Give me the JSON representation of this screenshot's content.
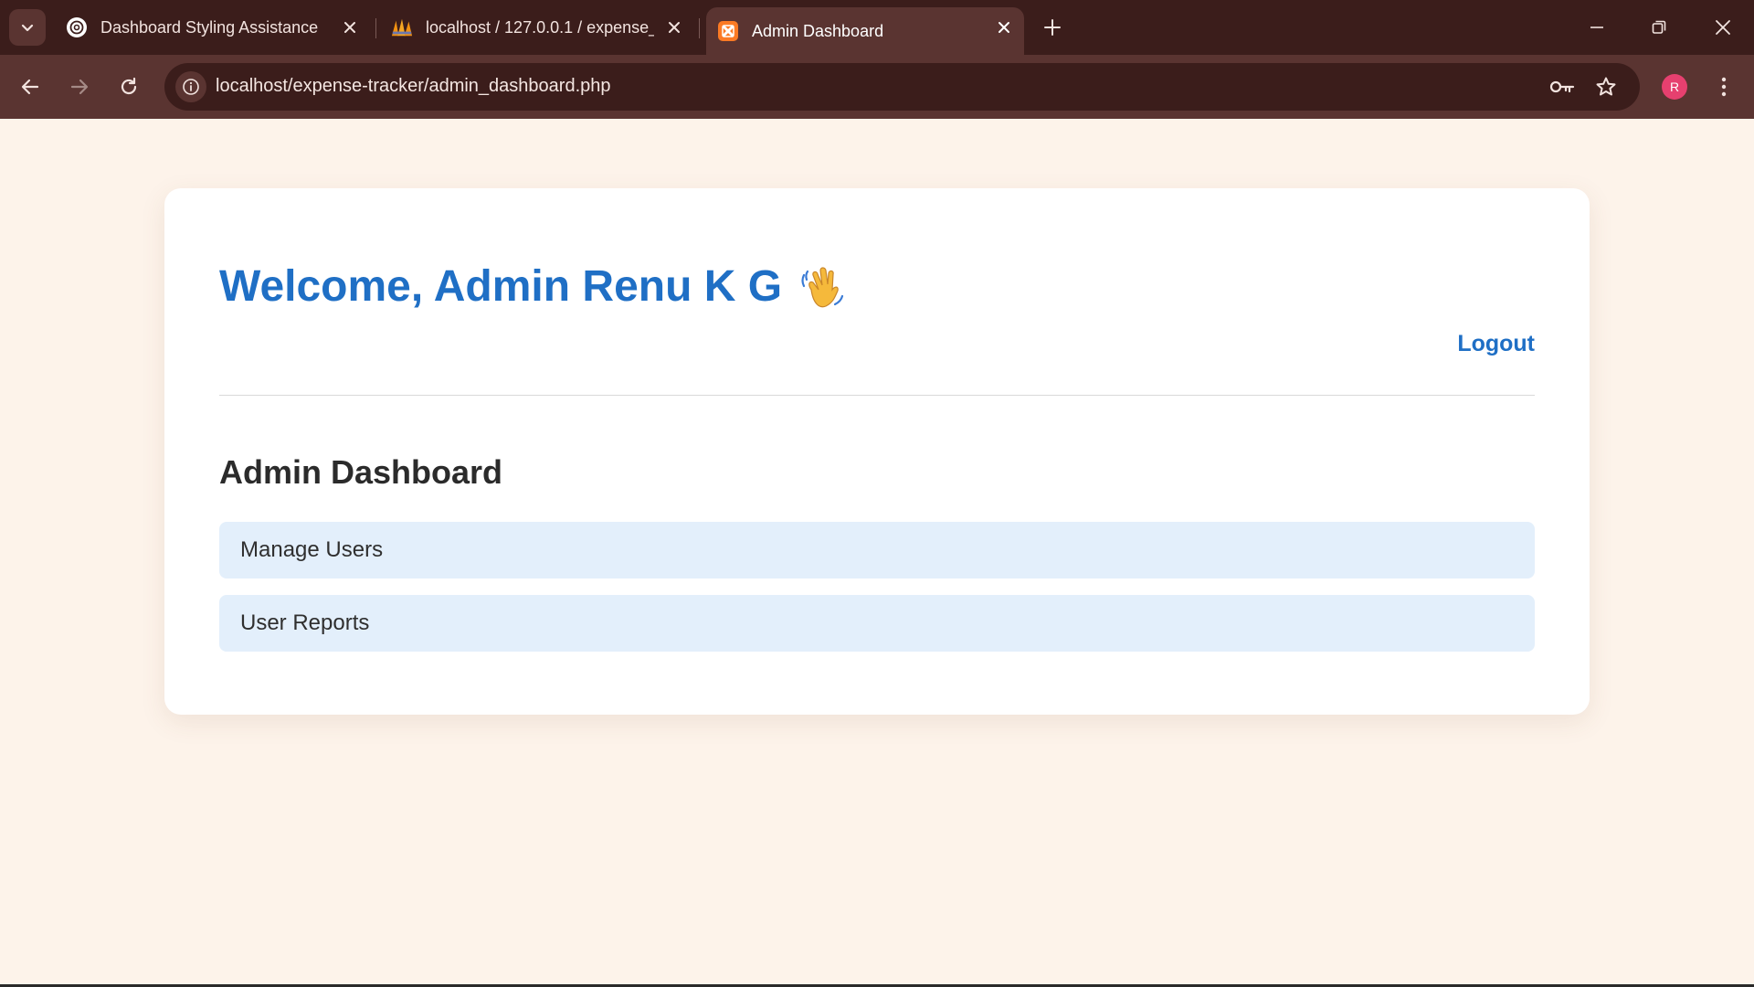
{
  "browser": {
    "tabs": [
      {
        "title": "Dashboard Styling Assistance",
        "favicon": "chatgpt-icon"
      },
      {
        "title": "localhost / 127.0.0.1 / expense_",
        "favicon": "phpmyadmin-icon"
      },
      {
        "title": "Admin Dashboard",
        "favicon": "xampp-icon",
        "active": true
      }
    ],
    "address": "localhost/expense-tracker/admin_dashboard.php",
    "profile_initial": "R",
    "colors": {
      "frame": "#3b1d1b",
      "toolbar": "#5a3431",
      "profile": "#e6406f"
    }
  },
  "page": {
    "welcome": "Welcome, Admin Renu K G",
    "welcome_icon": "waving-hand-icon",
    "logout": "Logout",
    "section_title": "Admin Dashboard",
    "links": [
      "Manage Users",
      "User Reports"
    ],
    "colors": {
      "background": "#fdf3ea",
      "accent": "#1f6fc5",
      "link_bg": "#e3effb"
    }
  }
}
